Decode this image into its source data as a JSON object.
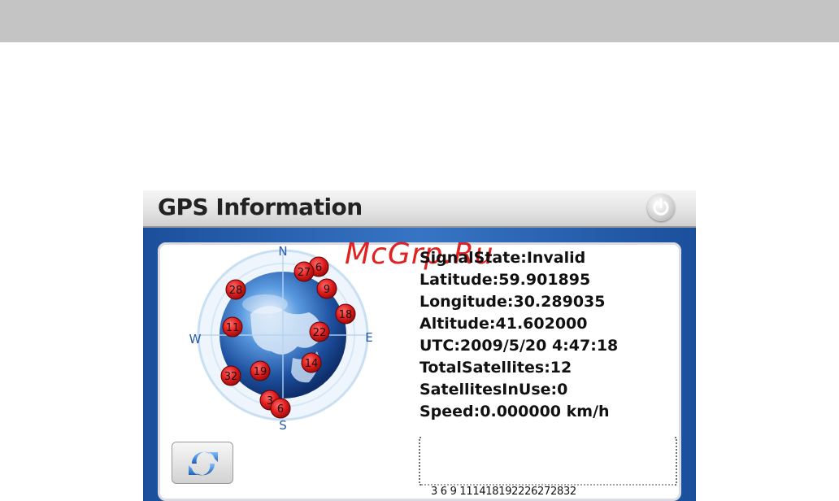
{
  "window": {
    "title": "GPS Information",
    "watermark": "McGrp.Ru"
  },
  "compass": {
    "north": "N",
    "south": "S",
    "east": "E",
    "west": "W"
  },
  "satellites": [
    {
      "prn": "27"
    },
    {
      "prn": "6"
    },
    {
      "prn": "9"
    },
    {
      "prn": "28"
    },
    {
      "prn": "18"
    },
    {
      "prn": "11"
    },
    {
      "prn": "22"
    },
    {
      "prn": "14"
    },
    {
      "prn": "19"
    },
    {
      "prn": "32"
    },
    {
      "prn": "3"
    },
    {
      "prn": "6"
    }
  ],
  "info": {
    "signal_state": "SignalState:Invalid",
    "latitude": "Latitude:59.901895",
    "longitude": "Longitude:30.289035",
    "altitude": "Altitude:41.602000",
    "utc": "UTC:2009/5/20 4:47:18",
    "total_satellites": "TotalSatellites:12",
    "satellites_in_use": "SatellitesInUse:0",
    "speed": "Speed:0.000000 km/h"
  },
  "signal_bars": {
    "labels": "3  6  9  111418192226272832"
  },
  "colors": {
    "satellite": "#e01b1b",
    "frame_blue": "#2a62b2",
    "top_bar": "#c4c4c4"
  },
  "icons": {
    "power": "power-icon",
    "refresh": "refresh-icon",
    "globe": "globe-icon"
  }
}
